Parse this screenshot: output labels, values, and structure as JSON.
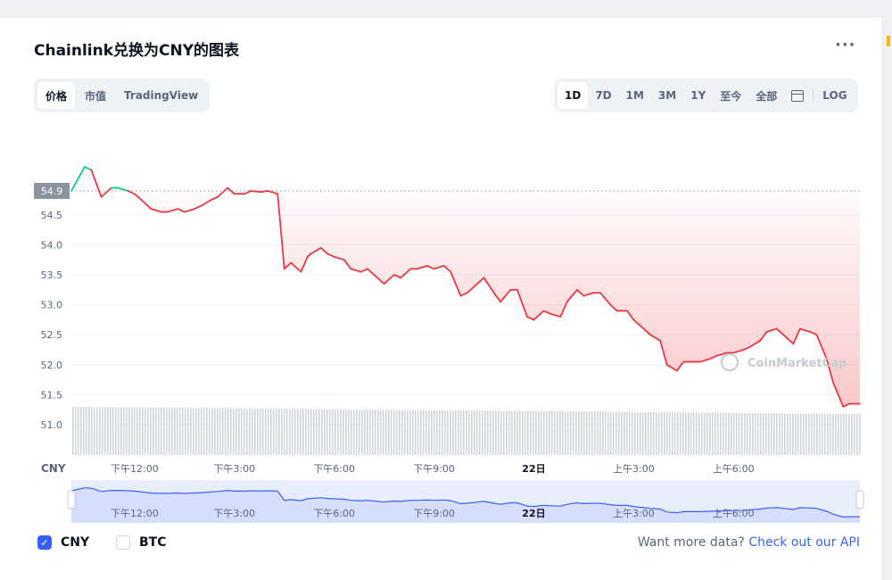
{
  "page": {
    "title": "Chainlink兑换为CNY的图表",
    "more_icon": "more-horizontal-icon"
  },
  "view_tabs": [
    {
      "label": "价格",
      "active": true
    },
    {
      "label": "市值",
      "active": false
    },
    {
      "label": "TradingView",
      "active": false
    }
  ],
  "range_tabs": [
    {
      "label": "1D",
      "active": true
    },
    {
      "label": "7D",
      "active": false
    },
    {
      "label": "1M",
      "active": false
    },
    {
      "label": "3M",
      "active": false
    },
    {
      "label": "1Y",
      "active": false
    },
    {
      "label": "至今",
      "active": false
    },
    {
      "label": "全部",
      "active": false
    }
  ],
  "calendar_icon": "calendar-icon",
  "log_label": "LOG",
  "legend": {
    "cny_label": "CNY",
    "cny_checked": true,
    "btc_label": "BTC",
    "btc_checked": false
  },
  "api": {
    "prefix": "Want more data?",
    "link": "Check out our API"
  },
  "watermark": "CoinMarketCap",
  "chart_data": {
    "type": "area",
    "currency_label": "CNY",
    "reference_price_label": "54.9",
    "reference_price": 54.9,
    "ylim": [
      51.0,
      56.0
    ],
    "y_ticks": [
      "54.5",
      "54.0",
      "53.5",
      "53.0",
      "52.5",
      "52.0",
      "51.5",
      "51.0"
    ],
    "x_ticks": [
      "下午12:00",
      "下午3:00",
      "下午6:00",
      "下午9:00",
      "22日",
      "上午3:00",
      "上午6:00"
    ],
    "x_tick_hours": [
      12,
      15,
      18,
      21,
      24,
      27,
      30
    ],
    "x_range_hours": [
      10.1,
      33.8
    ],
    "colors": {
      "up": "#16c784",
      "down": "#ea3943",
      "fill": "#ea3943",
      "navigator": "#3861fb"
    },
    "series": [
      {
        "hours": [
          10.1,
          10.5,
          10.7,
          11.0,
          11.3,
          11.5,
          11.8,
          12.0,
          12.3,
          12.5,
          12.8,
          13.0,
          13.3,
          13.5,
          13.8,
          14.0,
          14.3,
          14.5,
          14.8,
          15.0,
          15.3,
          15.5,
          15.8,
          16.0,
          16.3,
          16.5,
          16.7,
          17.0,
          17.2,
          17.3,
          17.6,
          17.8,
          18.0,
          18.3,
          18.5,
          18.8,
          19.0,
          19.3,
          19.5,
          19.8,
          20.0,
          20.3,
          20.5,
          20.8,
          21.0,
          21.3,
          21.5,
          21.8,
          22.0,
          22.3,
          22.5,
          22.8,
          23.0,
          23.3,
          23.5,
          23.8,
          24.0,
          24.3,
          24.5,
          24.8,
          25.0,
          25.3,
          25.5,
          25.8,
          26.0,
          26.3,
          26.5,
          26.8,
          27.0,
          27.3,
          27.5,
          27.8,
          28.0,
          28.3,
          28.5,
          28.8,
          29.0,
          29.3,
          29.5,
          29.8,
          30.0,
          30.3,
          30.5,
          30.8,
          31.0,
          31.3,
          31.5,
          31.8,
          32.0,
          32.3,
          32.5,
          32.8,
          33.0,
          33.3,
          33.5,
          33.8
        ],
        "values": [
          54.9,
          55.3,
          55.25,
          54.8,
          54.95,
          54.95,
          54.9,
          54.85,
          54.7,
          54.6,
          54.55,
          54.55,
          54.6,
          54.55,
          54.6,
          54.65,
          54.75,
          54.8,
          54.95,
          54.85,
          54.85,
          54.9,
          54.88,
          54.9,
          54.85,
          53.6,
          53.7,
          53.55,
          53.8,
          53.85,
          53.95,
          53.85,
          53.8,
          53.75,
          53.6,
          53.55,
          53.6,
          53.45,
          53.35,
          53.5,
          53.45,
          53.6,
          53.6,
          53.65,
          53.6,
          53.65,
          53.55,
          53.15,
          53.2,
          53.35,
          53.45,
          53.2,
          53.05,
          53.25,
          53.25,
          52.8,
          52.75,
          52.9,
          52.85,
          52.8,
          53.05,
          53.25,
          53.15,
          53.2,
          53.2,
          53.0,
          52.9,
          52.9,
          52.75,
          52.6,
          52.5,
          52.4,
          52.0,
          51.9,
          52.05,
          52.05,
          52.05,
          52.1,
          52.15,
          52.2,
          52.2,
          52.25,
          52.3,
          52.4,
          52.55,
          52.6,
          52.5,
          52.35,
          52.6,
          52.55,
          52.5,
          52.1,
          51.7,
          51.3,
          51.35,
          51.35
        ]
      }
    ]
  }
}
